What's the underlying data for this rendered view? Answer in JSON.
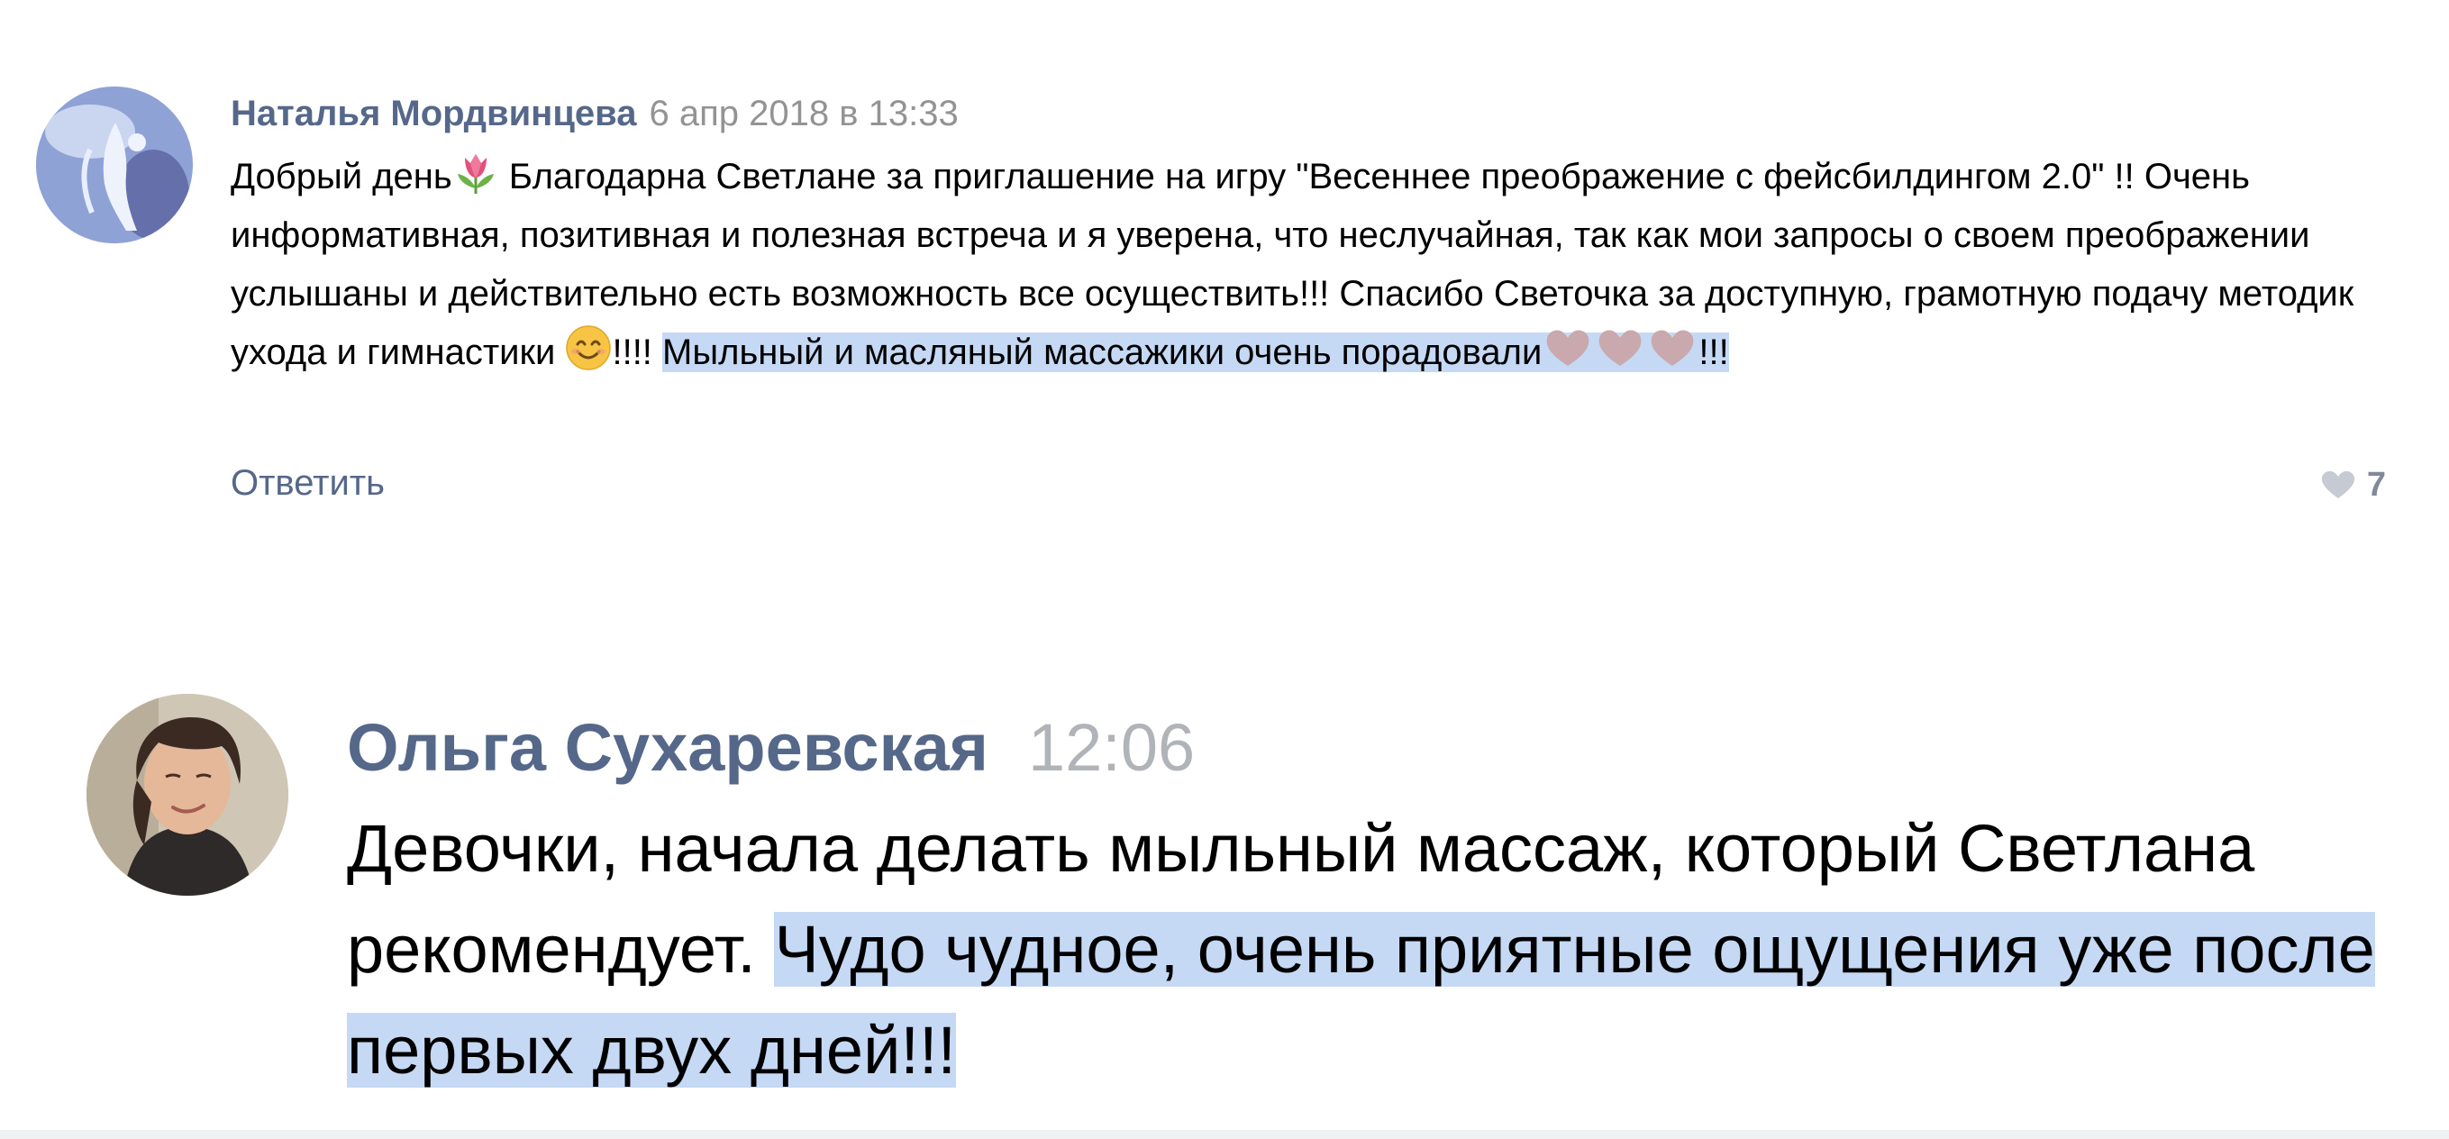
{
  "comments": [
    {
      "author": "Наталья Мордвинцева",
      "date": "6 апр 2018 в 13:33",
      "avatar_icon": "avatar-photo",
      "text_part1": "Добрый день",
      "tulip_icon": "tulip-emoji",
      "text_part2": " Благодарна Светлане за приглашение на игру \"Весеннее преображение с фейсбилдингом 2.0\" !! Очень информативная, позитивная и полезная встреча и я уверена, что неслучайная, так как мои запросы о своем преображении услышаны и действительно есть возможность все осуществить!!! Спасибо Светочка за доступную, грамотную подачу методик ухода и гимнастики ",
      "smile_icon": "smiling-face-emoji",
      "text_part3": "!!!! ",
      "highlighted_text": "Мыльный и масляный массажики очень порадовали",
      "heart_icons": [
        "heart-emoji",
        "heart-emoji",
        "heart-emoji"
      ],
      "highlighted_tail": "!!!",
      "reply_label": "Ответить",
      "like_icon": "heart-icon",
      "likes": "7"
    },
    {
      "author": "Ольга Сухаревская",
      "time": "12:06",
      "avatar_icon": "avatar-photo",
      "text_plain": "Девочки, начала делать мыльный массаж, который Светлана рекомендует. ",
      "text_highlighted": "Чудо чудное, очень приятные ощущения уже после первых двух дней!!!"
    }
  ],
  "colors": {
    "author": "#55688a",
    "date": "#939393",
    "highlight": "#c6d9f4",
    "heart_emoji": "#c9a9ad"
  }
}
